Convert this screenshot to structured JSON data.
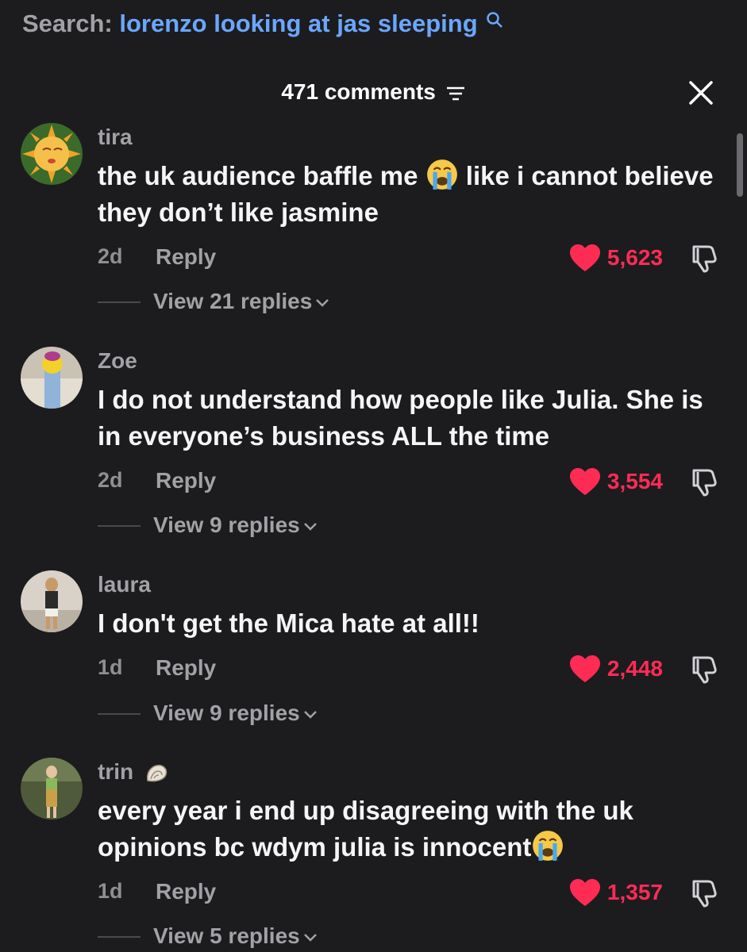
{
  "search": {
    "prefix": "Search:",
    "query": "lorenzo looking at jas sleeping",
    "icon": "search-icon"
  },
  "header": {
    "comments_count": "471 comments",
    "sort_icon": "sort-icon",
    "close_icon": "close-icon"
  },
  "colors": {
    "background": "#1c1c1e",
    "accent_blue": "#6aa7ff",
    "like_red": "#fe2c55",
    "secondary_text": "#a1a1a6"
  },
  "comments": [
    {
      "username": "tira",
      "text_parts": [
        "the uk audience baffle me",
        " like i cannot believe they don’t like jasmine"
      ],
      "emoji": "loudly-crying-face",
      "time": "2d",
      "reply_label": "Reply",
      "likes": "5,623",
      "view_replies": "View 21 replies"
    },
    {
      "username": "Zoe",
      "text": "I do not understand how people like Julia. She is in everyone’s business ALL the time",
      "time": "2d",
      "reply_label": "Reply",
      "likes": "3,554",
      "view_replies": "View 9 replies"
    },
    {
      "username": "laura",
      "text": "I don't get the Mica hate at all!!",
      "time": "1d",
      "reply_label": "Reply",
      "likes": "2,448",
      "view_replies": "View 9 replies"
    },
    {
      "username": "trin",
      "username_icon": "spiral-shell-icon",
      "text_parts": [
        "every year i end up disagreeing with the uk opinions bc wdym julia is innocent",
        ""
      ],
      "emoji": "loudly-crying-face",
      "time": "1d",
      "reply_label": "Reply",
      "likes": "1,357",
      "view_replies": "View 5 replies"
    }
  ]
}
